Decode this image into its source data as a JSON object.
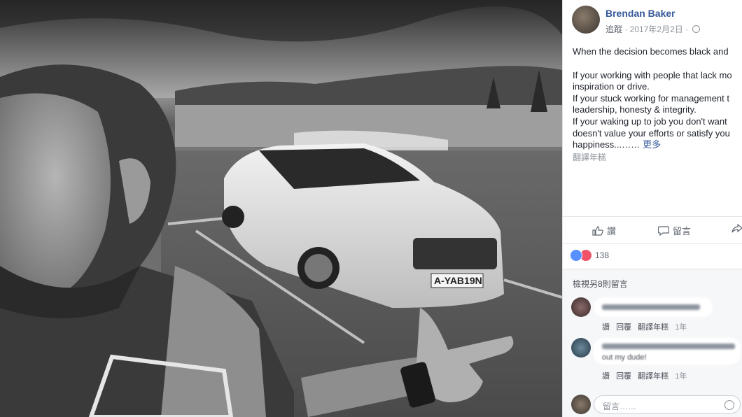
{
  "post": {
    "author": "Brendan Baker",
    "follow": "追蹤",
    "date": "2017年2月2日",
    "separator": "·",
    "text_lines": [
      "When the decision becomes black and",
      "",
      "If your working with people that lack mo",
      "inspiration or drive.",
      "If your stuck working for management t",
      "leadership, honesty & integrity.",
      "If your waking up to job you don't want",
      "doesn't value your efforts or satisfy you",
      "happiness...……"
    ],
    "more_label": "更多",
    "translate_label": "翻譯年糕",
    "photo": {
      "plate": "A-YAB19N"
    }
  },
  "actions": {
    "like": "讚",
    "comment": "留言",
    "share_icon": "share-icon"
  },
  "reactions": {
    "count": "138",
    "types": [
      "like",
      "love"
    ]
  },
  "comments": {
    "view_more": "檢視另8則留言",
    "items": [
      {
        "links": [
          "讚",
          "回覆",
          "翻譯年糕",
          "1年"
        ]
      },
      {
        "partial_text": "out my dude!",
        "links": [
          "讚",
          "回覆",
          "翻譯年糕",
          "1年"
        ]
      }
    ],
    "composer_placeholder": "留言……"
  },
  "colors": {
    "link_blue": "#365899",
    "meta_gray": "#90949c",
    "like_blue": "#5890ff",
    "love_red": "#f25268"
  }
}
